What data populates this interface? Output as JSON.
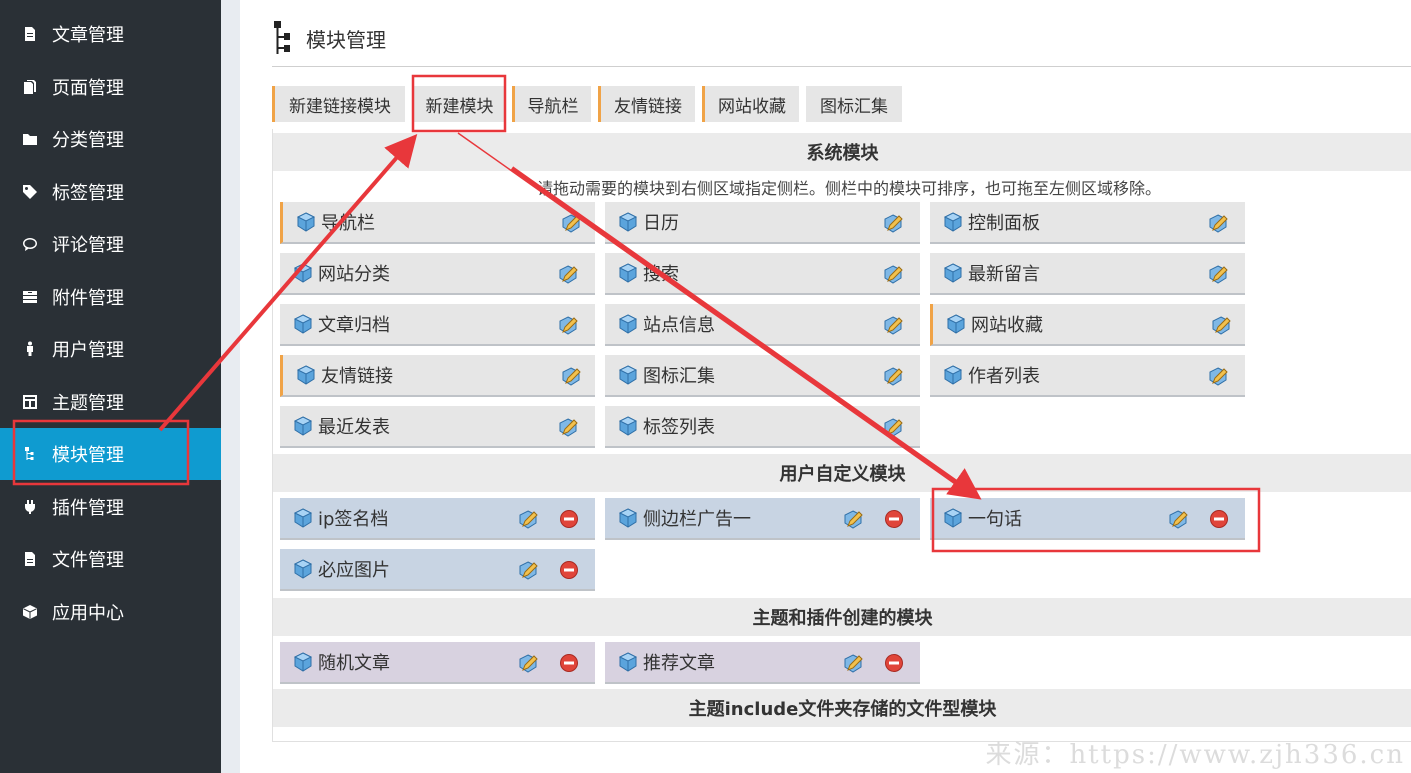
{
  "sidebar": {
    "items": [
      {
        "label": "文章管理",
        "icon": "document-icon"
      },
      {
        "label": "页面管理",
        "icon": "pages-icon"
      },
      {
        "label": "分类管理",
        "icon": "folder-icon"
      },
      {
        "label": "标签管理",
        "icon": "tag-icon"
      },
      {
        "label": "评论管理",
        "icon": "comment-icon"
      },
      {
        "label": "附件管理",
        "icon": "attachment-icon"
      },
      {
        "label": "用户管理",
        "icon": "user-icon"
      },
      {
        "label": "主题管理",
        "icon": "theme-icon"
      },
      {
        "label": "模块管理",
        "icon": "module-icon",
        "active": true
      },
      {
        "label": "插件管理",
        "icon": "plugin-icon"
      },
      {
        "label": "文件管理",
        "icon": "file-icon"
      },
      {
        "label": "应用中心",
        "icon": "app-center-icon"
      }
    ]
  },
  "page": {
    "title": "模块管理"
  },
  "tabs": [
    "新建链接模块",
    "新建模块",
    "导航栏",
    "友情链接",
    "网站收藏",
    "图标汇集"
  ],
  "sections": {
    "system": {
      "title": "系统模块",
      "hint": "请拖动需要的模块到右侧区域指定侧栏。侧栏中的模块可排序，也可拖至左侧区域移除。",
      "modules": [
        "导航栏",
        "日历",
        "控制面板",
        "网站分类",
        "搜索",
        "最新留言",
        "文章归档",
        "站点信息",
        "网站收藏",
        "友情链接",
        "图标汇集",
        "作者列表",
        "最近发表",
        "标签列表"
      ]
    },
    "user": {
      "title": "用户自定义模块",
      "modules": [
        "ip签名档",
        "侧边栏广告一",
        "一句话",
        "必应图片"
      ]
    },
    "theme": {
      "title": "主题和插件创建的模块",
      "modules": [
        "随机文章",
        "推荐文章"
      ]
    },
    "include": {
      "title": "主题include文件夹存储的文件型模块"
    }
  },
  "watermark": "来源：https://www.zjh336.cn",
  "colors": {
    "sidebar_bg": "#2a3036",
    "sidebar_active": "#0f9bd0",
    "accent_orange": "#f0a347",
    "annotation_red": "#e8373b"
  }
}
